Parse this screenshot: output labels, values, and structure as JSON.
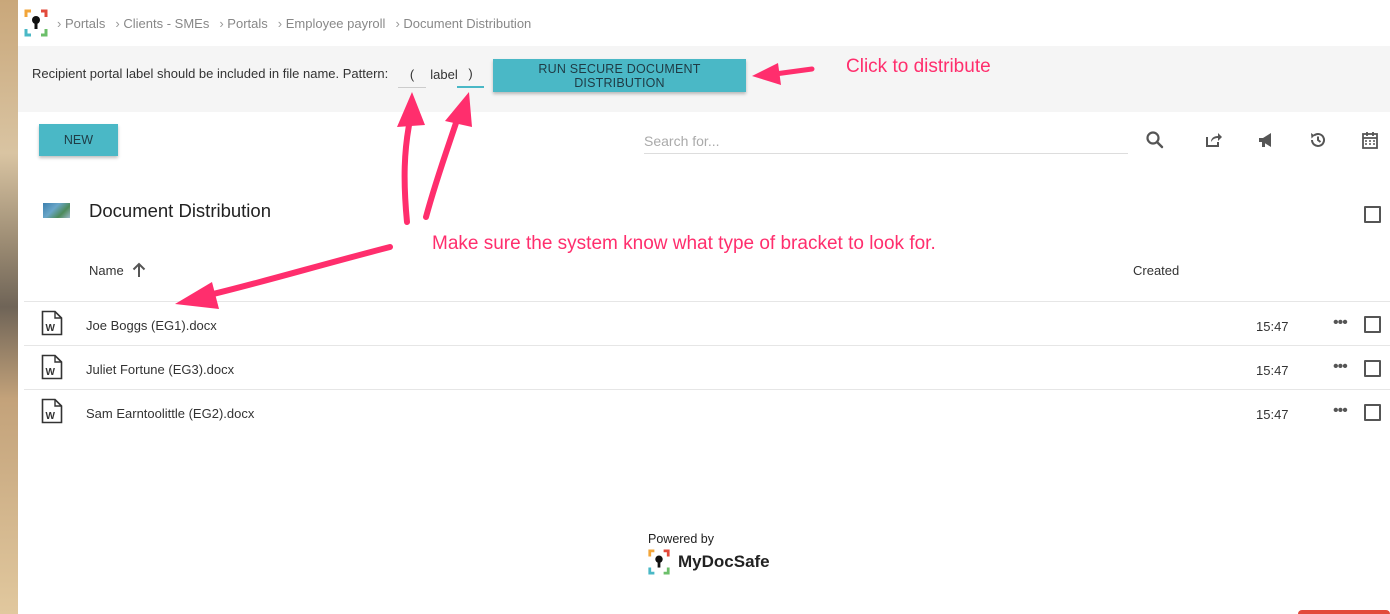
{
  "breadcrumb": {
    "items": [
      "Portals",
      "Clients - SMEs",
      "Portals",
      "Employee payroll",
      "Document Distribution"
    ]
  },
  "distribution": {
    "pattern_text": "Recipient portal label should be included in file name. Pattern:",
    "open_bracket": "(",
    "label": "label",
    "close_bracket": ")",
    "run_button": "RUN SECURE DOCUMENT DISTRIBUTION"
  },
  "toolbar": {
    "new_button": "NEW",
    "search_placeholder": "Search for...",
    "icons": [
      "search-icon",
      "share-icon",
      "megaphone-icon",
      "history-icon",
      "calendar-icon"
    ]
  },
  "folder": {
    "title": "Document Distribution"
  },
  "columns": {
    "name": "Name",
    "created": "Created"
  },
  "files": [
    {
      "name": "Joe Boggs (EG1).docx",
      "created": "15:47"
    },
    {
      "name": "Juliet Fortune (EG3).docx",
      "created": "15:47"
    },
    {
      "name": "Sam Earntoolittle (EG2).docx",
      "created": "15:47"
    }
  ],
  "footer": {
    "powered_by": "Powered by",
    "brand": "MyDocSafe"
  },
  "annotations": {
    "click_note": "Click to distribute",
    "bracket_note": "Make sure the system know what type of bracket to look for."
  },
  "colors": {
    "accent": "#4ab8c6",
    "annotation": "#ff2e6d"
  }
}
